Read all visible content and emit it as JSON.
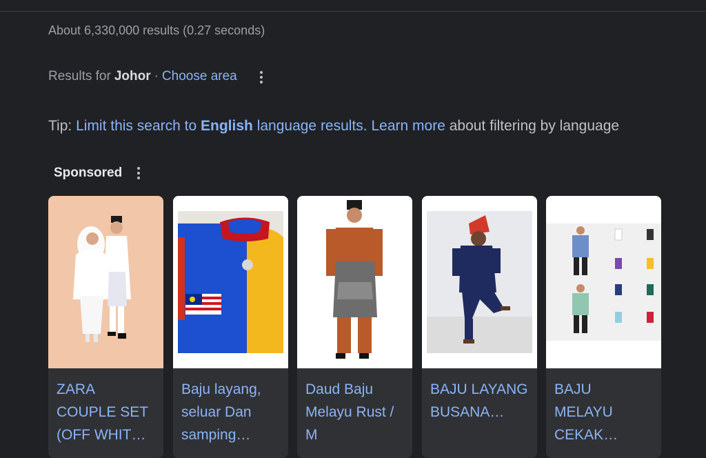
{
  "results": {
    "stats": "About 6,330,000 results (0.27 seconds)"
  },
  "location": {
    "prefix": "Results for",
    "place": "Johor",
    "separator": "·",
    "choose_area": "Choose area"
  },
  "tip": {
    "label": "Tip:",
    "link_part1": "Limit this search to",
    "language": "English",
    "link_part2": "language results.",
    "learn_more": "Learn more",
    "suffix": "about filtering by language"
  },
  "sponsored": {
    "label": "Sponsored",
    "products": [
      {
        "title": "ZARA COUPLE SET (OFF WHIT…"
      },
      {
        "title": "Baju layang, seluar Dan samping…"
      },
      {
        "title": "Daud Baju Melayu Rust / M"
      },
      {
        "title": "BAJU LAYANG BUSANA…"
      },
      {
        "title": "BAJU MELAYU CEKAK…"
      }
    ]
  },
  "colors": {
    "background": "#202124",
    "link": "#8ab4f8",
    "card": "#303134"
  }
}
